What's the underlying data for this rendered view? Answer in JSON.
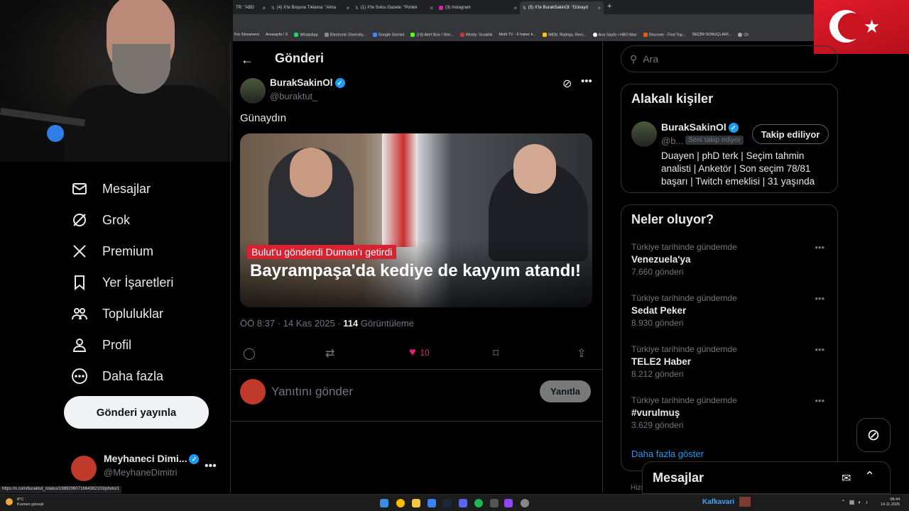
{
  "browser": {
    "tabs": [
      {
        "label": "TR: \"ABD",
        "active": false
      },
      {
        "label": "(4) X'te Boşuna Tıklama: \"Alma",
        "active": false
      },
      {
        "label": "(1) X'te Solcu Gazete: \"Portek",
        "active": false
      },
      {
        "label": "(3) Instagram",
        "active": false
      },
      {
        "label": "(5) X'te BurakSakinOl: \"Günayd",
        "active": true
      }
    ],
    "new_tab": "+",
    "bookmarks": [
      "For Streamers",
      "Anasayfa / X",
      "WhatsApp",
      "Electronic Diversity...",
      "Google Gemini",
      "(19) Alert Box / Stre...",
      "Windy: Sıcaklık",
      "Multi TV - 6 haber k...",
      "IMDb: Ratings, Revi...",
      "Ana Sayfa • HBO Max",
      "Discover - Find Top...",
      "SEÇİM SONUÇLARI...",
      "Ch"
    ],
    "status_url": "https://x.com/buraktut_/status/1989206071664382103/photo/1"
  },
  "sidebar": {
    "items": [
      {
        "label": "Mesajlar",
        "icon": "mail-icon"
      },
      {
        "label": "Grok",
        "icon": "grok-icon"
      },
      {
        "label": "Premium",
        "icon": "x-logo-icon"
      },
      {
        "label": "Yer İşaretleri",
        "icon": "bookmark-icon"
      },
      {
        "label": "Topluluklar",
        "icon": "communities-icon"
      },
      {
        "label": "Profil",
        "icon": "profile-icon"
      },
      {
        "label": "Daha fazla",
        "icon": "more-circle-icon"
      }
    ],
    "post_button": "Gönderi yayınla",
    "account": {
      "name": "Meyhaneci Dimi...",
      "handle": "@MeyhaneDimitri",
      "more": "•••"
    }
  },
  "post": {
    "header_title": "Gönderi",
    "author_name": "BurakSakinOl",
    "author_handle": "@buraktut_",
    "text": "Günaydın",
    "media_subtitle": "Bulut'u gönderdi Duman'ı getirdi",
    "media_headline": "Bayrampaşa'da kediye de kayyım atandı!",
    "time": "ÖÖ 8:37 · 14 Kas 2025 · ",
    "views_count": "114",
    "views_label": " Görüntüleme",
    "likes": "10",
    "reply_placeholder": "Yanıtını gönder",
    "reply_button": "Yanıtla",
    "more": "•••"
  },
  "search": {
    "placeholder": "Ara"
  },
  "related": {
    "title": "Alakalı kişiler",
    "name": "BurakSakinOl",
    "handle": "@b...",
    "follows_you": "Seni takip ediyor",
    "follow_button": "Takip ediliyor",
    "bio": "Duayen | phD terk | Seçim tahmin analisti | Anketör | Son seçim 78/81 başarı | Twitch emeklisi | 31 yaşında"
  },
  "trends": {
    "title": "Neler oluyor?",
    "items": [
      {
        "context": "Türkiye tarihinde gündemde",
        "topic": "Venezuela'ya",
        "count": "7.660 gönderi"
      },
      {
        "context": "Türkiye tarihinde gündemde",
        "topic": "Sedat Peker",
        "count": "8.930 gönderi"
      },
      {
        "context": "Türkiye tarihinde gündemde",
        "topic": "TELE2 Haber",
        "count": "8.212 gönderi"
      },
      {
        "context": "Türkiye tarihinde gündemde",
        "topic": "#vurulmuş",
        "count": "3.629 gönderi"
      }
    ],
    "show_more": "Daha fazla göster",
    "more": "•••"
  },
  "messages_drawer": {
    "title": "Mesajlar"
  },
  "footer_partial": "Hizı",
  "taskbar": {
    "weather_temp": "8°C",
    "weather_desc": "Kısmen güneşli",
    "streamer": "Kafkavari",
    "time": "08:44",
    "date": "14.11.2025"
  },
  "colors": {
    "accent": "#1d9bf0",
    "like": "#f91880",
    "flag_red": "#e21b2a",
    "media_label": "#d62231"
  }
}
